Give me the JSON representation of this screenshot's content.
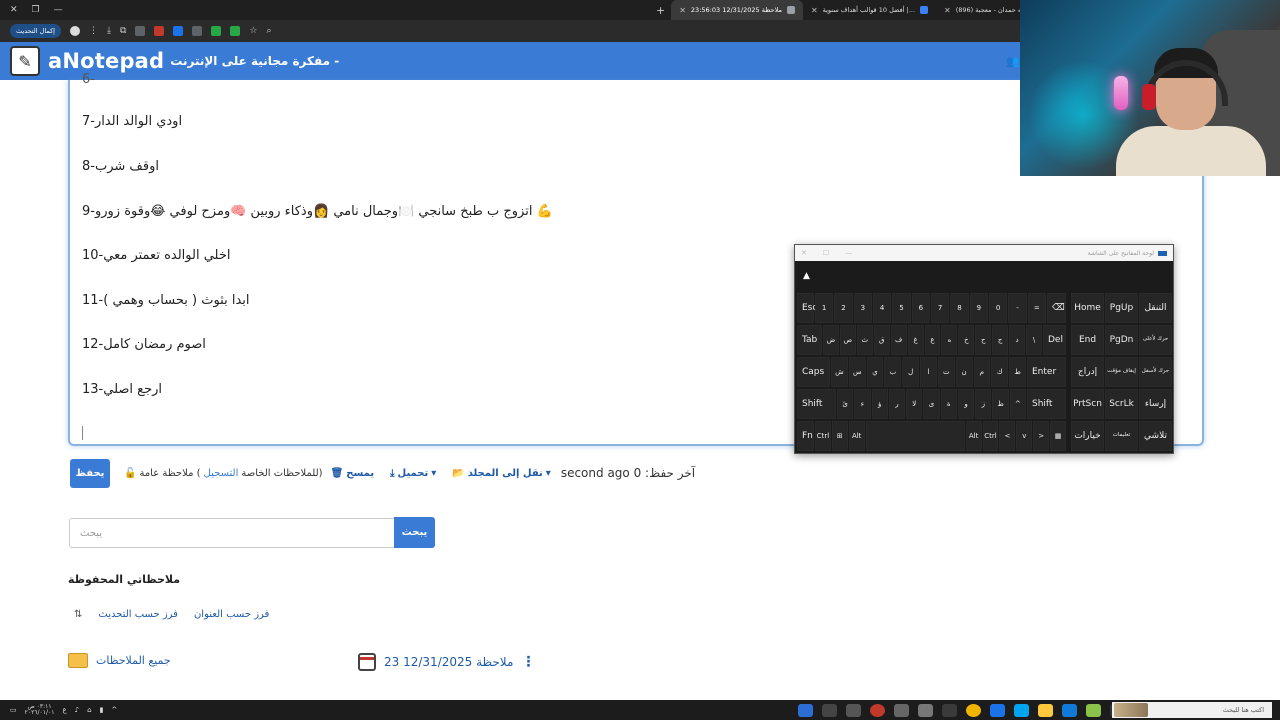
{
  "browser": {
    "tabs": [
      {
        "title": "ملاحظة 12/31/2025 23:56:03",
        "active": true
      },
      {
        "title": "أفضل 10 قوالب أهداف سنوية |...",
        "active": false
      },
      {
        "title": "(896) شمه حمدان - معجبة |...",
        "active": false
      }
    ],
    "update_label": "إكمال التحديث"
  },
  "site": {
    "brand": "aNotepad",
    "tagline": "مفكرة مجانية على الإنترنت -"
  },
  "note": {
    "lines": [
      "اودي الوالد الدار-7",
      "اوقف شرب-8",
      "اتزوج ب طبخ سانجي 🍽️وجمال نامي 👩وذكاء روبين 🧠ومزح لوفي 😂وقوة زورو-9 💪",
      "اخلي الوالده تعمتر معي-10",
      "ابدا بثوث ( بحساب وهمي )-11",
      "اصوم رمضان كامل-12",
      "ارجع اصلي-13"
    ],
    "partial_top_line": "6-"
  },
  "actions": {
    "save": "يحفظ",
    "visibility_prefix": "ملاحظة عامة (",
    "visibility_link": "التسجيل",
    "visibility_suffix": "للملاحظات الخاصة)",
    "delete": "يمسح",
    "download": "تحميل",
    "move_to_folder": "نقل إلى المجلد",
    "last_saved": "second ago آخر حفظ: 0"
  },
  "search": {
    "placeholder": "يبحث",
    "button": "يبحث"
  },
  "saved": {
    "title": "ملاحظاتي المحفوظة",
    "sort_by_title": "فرز حسب العنوان",
    "sort_by_update": "فرز حسب التحديث",
    "all_notes": "جميع الملاحظات",
    "note_item": "ملاحظة 12/31/2025 23"
  },
  "keyboard": {
    "title": "لوحة المفاتيح على الشاشة",
    "rows": [
      [
        "Esc",
        "1",
        "2",
        "3",
        "4",
        "5",
        "6",
        "7",
        "8",
        "9",
        "0",
        "-",
        "=",
        "⌫"
      ],
      [
        "Tab",
        "ض",
        "ص",
        "ث",
        "ق",
        "ف",
        "غ",
        "ع",
        "ه",
        "خ",
        "ح",
        "ج",
        "د",
        "\\",
        "Del"
      ],
      [
        "Caps",
        "ش",
        "س",
        "ي",
        "ب",
        "ل",
        "ا",
        "ت",
        "ن",
        "م",
        "ك",
        "ط",
        "Enter"
      ],
      [
        "Shift",
        "ئ",
        "ء",
        "ؤ",
        "ر",
        "لا",
        "ى",
        "ة",
        "و",
        "ز",
        "ظ",
        "^",
        "Shift"
      ],
      [
        "Fn",
        "Ctrl",
        "⊞",
        "Alt",
        "",
        "Alt",
        "Ctrl",
        "<",
        "v",
        ">",
        "▦"
      ]
    ],
    "side_keys": [
      [
        "Home",
        "PgUp",
        "التنقل"
      ],
      [
        "End",
        "PgDn",
        "حرك لأعلى"
      ],
      [
        "إدراج",
        "إيقاف مؤقت",
        "حرك لأسفل"
      ],
      [
        "PrtScn",
        "ScrLk",
        "إرساء"
      ],
      [
        "خيارات",
        "تعليمات",
        "تلاشي"
      ]
    ]
  },
  "taskbar": {
    "search_placeholder": "اكتب هنا للبحث",
    "time": "٠٣:١١ ص",
    "date": "٢٠٢٦/٠١/٠١"
  }
}
